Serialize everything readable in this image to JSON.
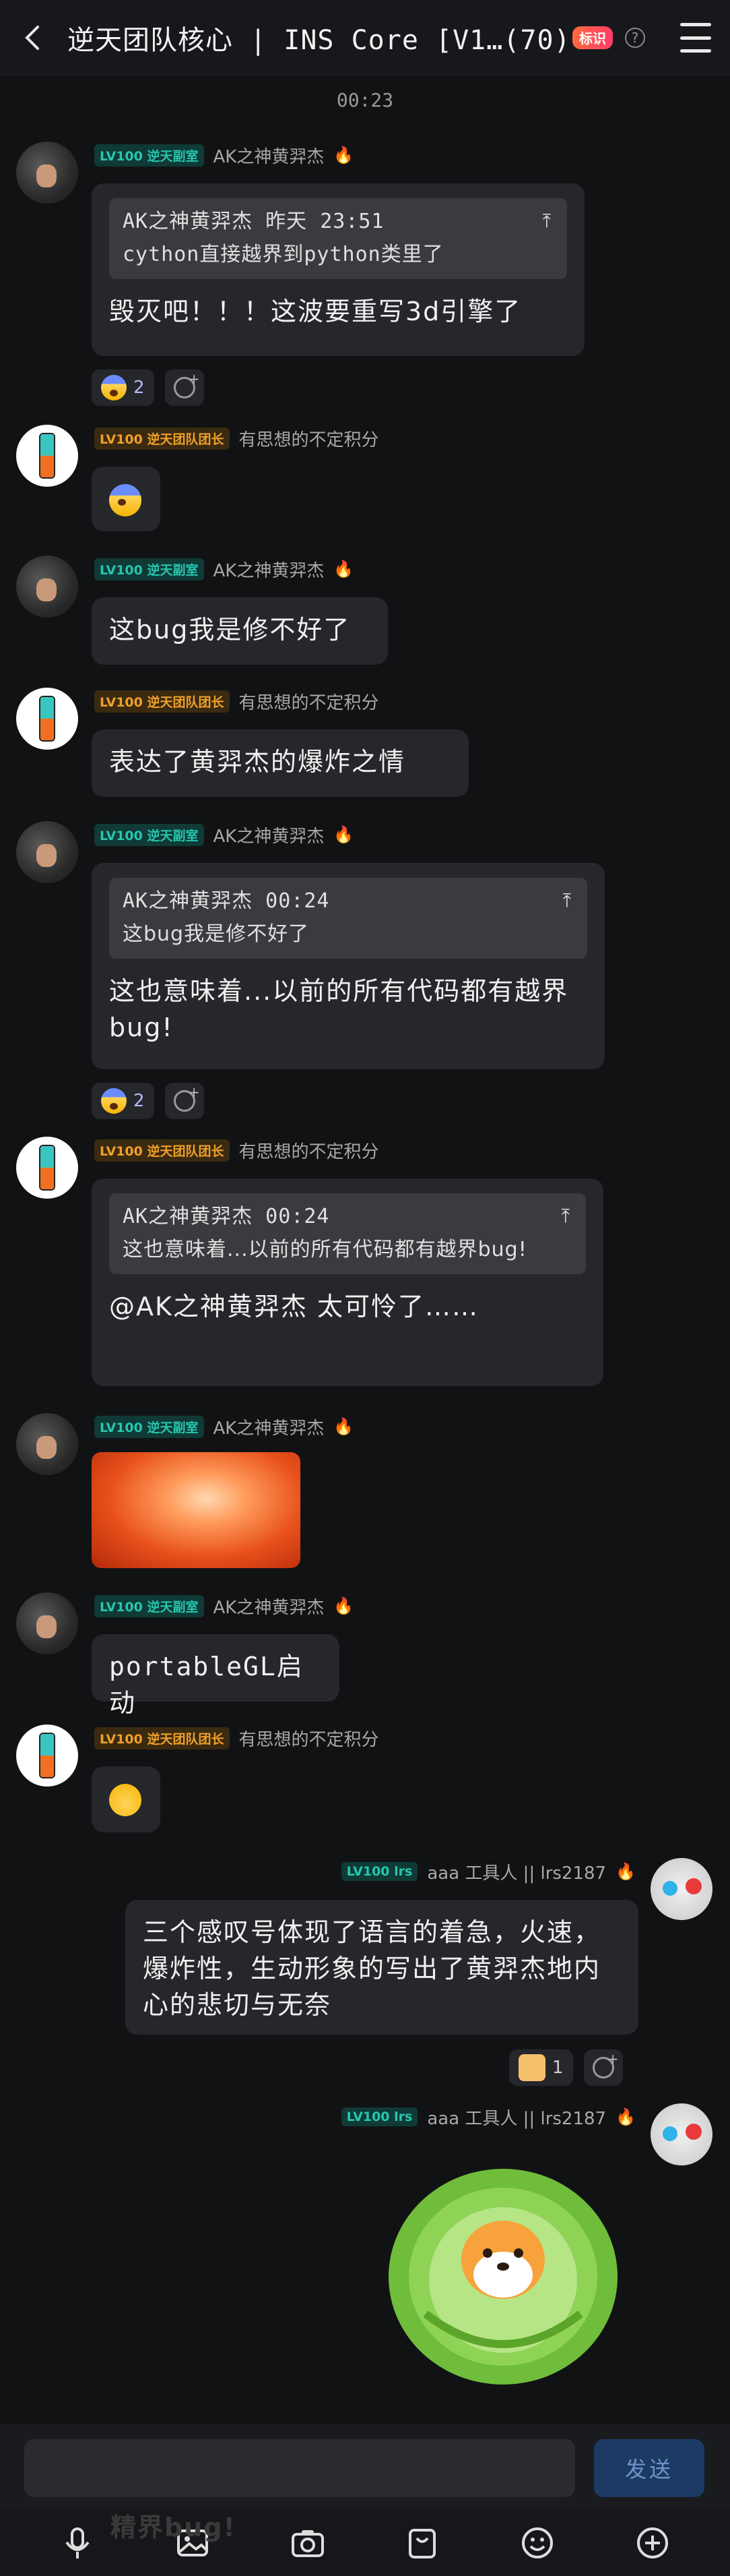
{
  "header": {
    "title": "逆天团队核心 | INS Core [V1…(70)",
    "badge": "标识"
  },
  "time_separator": "00:23",
  "messages": [
    {
      "level": "LV100",
      "role": "逆天副室",
      "name": "AK之神黄羿杰",
      "quote_head": "AK之神黄羿杰 昨天 23:51",
      "quote_body": "cython直接越界到python类里了",
      "text": "毁灭吧！！！这波要重写3d引擎了",
      "react_count": "2"
    },
    {
      "level": "LV100",
      "role": "逆天团队团长",
      "name": "有思想的不定积分"
    },
    {
      "level": "LV100",
      "role": "逆天副室",
      "name": "AK之神黄羿杰",
      "text": "这bug我是修不好了"
    },
    {
      "level": "LV100",
      "role": "逆天团队团长",
      "name": "有思想的不定积分",
      "text": "表达了黄羿杰的爆炸之情"
    },
    {
      "level": "LV100",
      "role": "逆天副室",
      "name": "AK之神黄羿杰",
      "quote_head": "AK之神黄羿杰 00:24",
      "quote_body": "这bug我是修不好了",
      "text": "这也意味着...以前的所有代码都有越界bug!",
      "react_count": "2"
    },
    {
      "level": "LV100",
      "role": "逆天团队团长",
      "name": "有思想的不定积分",
      "quote_head": "AK之神黄羿杰 00:24",
      "quote_body": "这也意味着...以前的所有代码都有越界bug!",
      "text": "@AK之神黄羿杰 太可怜了……"
    },
    {
      "level": "LV100",
      "role": "逆天副室",
      "name": "AK之神黄羿杰"
    },
    {
      "level": "LV100",
      "role": "逆天副室",
      "name": "AK之神黄羿杰",
      "text": "portableGL启动"
    },
    {
      "level": "LV100",
      "role": "逆天团队团长",
      "name": "有思想的不定积分"
    },
    {
      "level": "LV100",
      "role": "lrs",
      "name": "aaa 工具人 || lrs2187",
      "text": "三个感叹号体现了语言的着急，火速，爆炸性，生动形象的写出了黄羿杰地内心的悲切与无奈",
      "react_count": "1"
    },
    {
      "level": "LV100",
      "role": "lrs",
      "name": "aaa 工具人 || lrs2187"
    }
  ],
  "input": {
    "placeholder": "",
    "send_label": "发送"
  },
  "toolbar": {
    "ghost_text": "精界bug!"
  },
  "colors": {
    "background": "#111214",
    "bubble": "#26272b",
    "teal_badge": "#26c6b0",
    "orange_badge": "#f0a028",
    "send": "#1c3a64"
  },
  "icons": [
    "back-arrow-icon",
    "help-icon",
    "menu-icon",
    "fire-icon",
    "mic-icon",
    "image-icon",
    "camera-icon",
    "bag-icon",
    "emoji-icon",
    "plus-icon"
  ]
}
